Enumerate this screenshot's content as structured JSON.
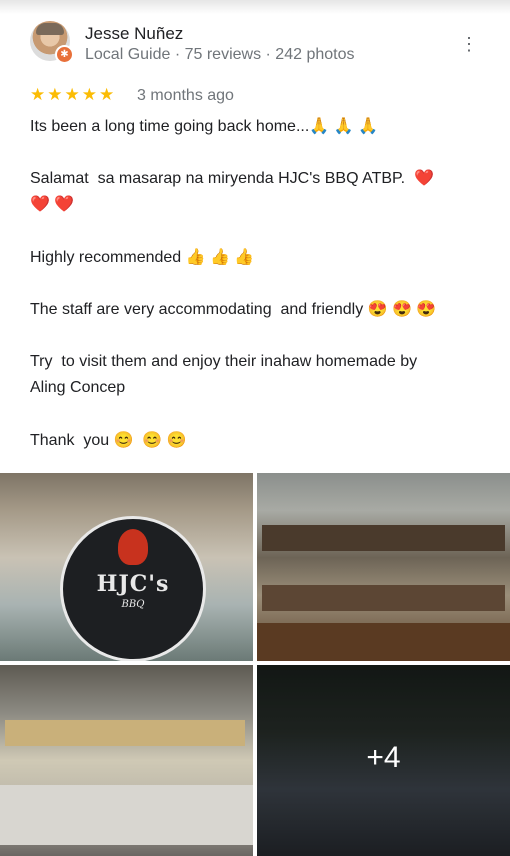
{
  "review": {
    "author": "Jesse Nuñez",
    "meta": "Local Guide · 75 reviews · 242 photos",
    "stars": "★★★★★",
    "rating": 5,
    "time": "3 months ago",
    "lines": [
      "Its been a long time going back home...🙏 🙏 🙏",
      "Salamat  sa masarap na miryenda HJC's BBQ ATBP.  ❤️\n❤️ ❤️",
      "Highly recommended 👍 👍 👍",
      "The staff are very accommodating  and friendly 😍 😍 😍",
      "Try  to visit them and enjoy their inahaw homemade by\nAling Concep",
      "Thank  you 😊  😊 😊"
    ]
  },
  "icons": {
    "menu": "more-vert-icon",
    "badge": "local-guide-badge-icon"
  },
  "photos": {
    "logo_text": "HJC's",
    "logo_sub": "BBQ",
    "more_count": "+4"
  }
}
